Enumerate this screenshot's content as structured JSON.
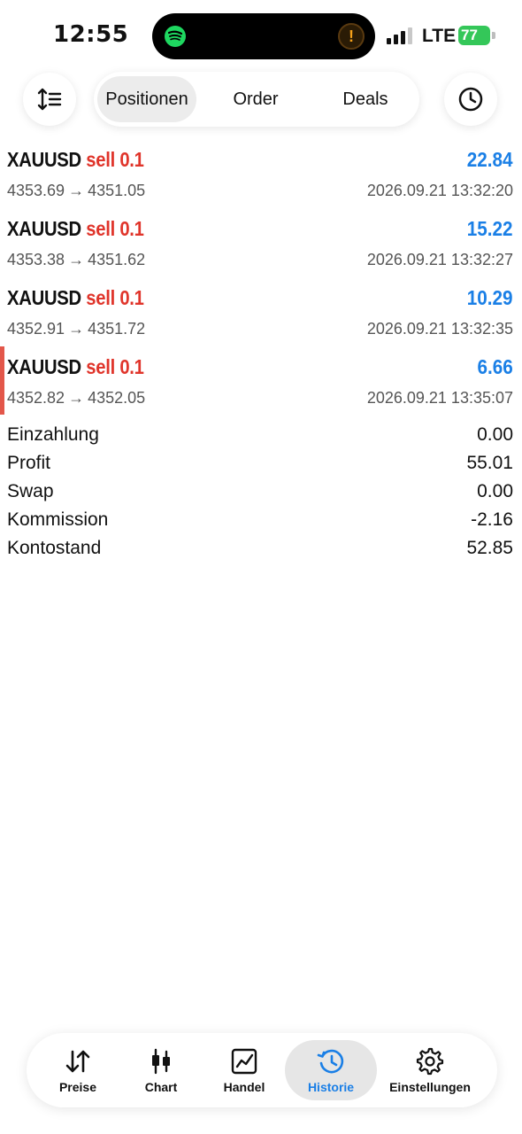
{
  "status_bar": {
    "time": "12:55",
    "network": "LTE",
    "battery": "77"
  },
  "top_nav": {
    "tabs": [
      {
        "label": "Positionen",
        "active": true
      },
      {
        "label": "Order",
        "active": false
      },
      {
        "label": "Deals",
        "active": false
      }
    ],
    "left_icon": "sort-icon",
    "right_icon": "clock-icon"
  },
  "deals": [
    {
      "symbol": "XAUUSD",
      "type": "sell 0.1",
      "profit": "22.84",
      "open_price": "4353.69",
      "arrow": "→",
      "close_price": "4351.05",
      "time": "2026.09.21 13:32:20"
    },
    {
      "symbol": "XAUUSD",
      "type": "sell 0.1",
      "profit": "15.22",
      "open_price": "4353.38",
      "arrow": "→",
      "close_price": "4351.62",
      "time": "2026.09.21 13:32:27"
    },
    {
      "symbol": "XAUUSD",
      "type": "sell 0.1",
      "profit": "10.29",
      "open_price": "4352.91",
      "arrow": "→",
      "close_price": "4351.72",
      "time": "2026.09.21 13:32:35"
    },
    {
      "symbol": "XAUUSD",
      "type": "sell 0.1",
      "profit": "6.66",
      "open_price": "4352.82",
      "arrow": "→",
      "close_price": "4352.05",
      "time": "2026.09.21 13:35:07"
    }
  ],
  "summary": [
    {
      "label": "Einzahlung",
      "value": "0.00"
    },
    {
      "label": "Profit",
      "value": "55.01"
    },
    {
      "label": "Swap",
      "value": "0.00"
    },
    {
      "label": "Kommission",
      "value": "-2.16"
    },
    {
      "label": "Kontostand",
      "value": "52.85"
    }
  ],
  "bottom_nav": {
    "items": [
      {
        "label": "Preise",
        "icon": "quotes-arrows-icon",
        "active": false
      },
      {
        "label": "Chart",
        "icon": "candlestick-chart-icon",
        "active": false
      },
      {
        "label": "Handel",
        "icon": "trade-chart-icon",
        "active": false
      },
      {
        "label": "Historie",
        "icon": "history-icon",
        "active": true
      },
      {
        "label": "Einstellungen",
        "icon": "gear-icon",
        "active": false
      }
    ]
  },
  "colors": {
    "sell": "#e0352b",
    "profit": "#1a7fe6",
    "active_tab": "#1a7fe6",
    "marker": "#e3574a"
  }
}
